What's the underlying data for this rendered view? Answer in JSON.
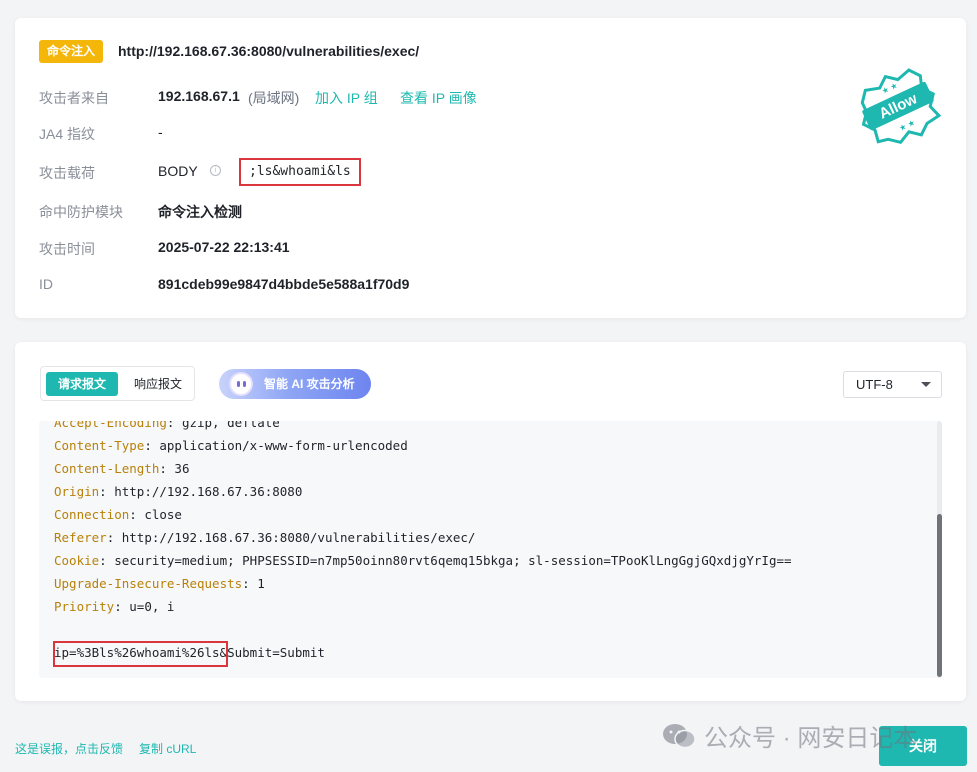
{
  "event": {
    "tag": "命令注入",
    "url": "http://192.168.67.36:8080/vulnerabilities/exec/",
    "stamp_text": "Allow",
    "rows": {
      "source": {
        "label": "攻击者来自",
        "ip": "192.168.67.1",
        "network": "(局域网)",
        "add_ip_group": "加入 IP 组",
        "view_profile": "查看 IP 画像"
      },
      "ja4": {
        "label": "JA4 指纹",
        "value": "-"
      },
      "payload": {
        "label": "攻击载荷",
        "location": "BODY",
        "value": ";ls&whoami&ls"
      },
      "module": {
        "label": "命中防护模块",
        "value": "命令注入检测"
      },
      "time": {
        "label": "攻击时间",
        "value": "2025-07-22 22:13:41"
      },
      "id": {
        "label": "ID",
        "value": "891cdeb99e9847d4bbde5e588a1f70d9"
      }
    }
  },
  "detail": {
    "tabs": {
      "request": "请求报文",
      "response": "响应报文"
    },
    "ai_button": "智能 AI 攻击分析",
    "encoding": "UTF-8",
    "headers": [
      {
        "key": "Accept-Encoding",
        "value": "gzip, deflate"
      },
      {
        "key": "Content-Type",
        "value": "application/x-www-form-urlencoded"
      },
      {
        "key": "Content-Length",
        "value": "36"
      },
      {
        "key": "Origin",
        "value": "http://192.168.67.36:8080"
      },
      {
        "key": "Connection",
        "value": "close"
      },
      {
        "key": "Referer",
        "value": "http://192.168.67.36:8080/vulnerabilities/exec/"
      },
      {
        "key": "Cookie",
        "value": "security=medium; PHPSESSID=n7mp50oinn80rvt6qemq15bkga; sl-session=TPooKlLngGgjGQxdjgYrIg=="
      },
      {
        "key": "Upgrade-Insecure-Requests",
        "value": "1"
      },
      {
        "key": "Priority",
        "value": "u=0, i"
      }
    ],
    "body": "ip=%3Bls%26whoami%26ls&Submit=Submit"
  },
  "footer": {
    "report_false_positive": "这是误报，点击反馈",
    "copy_curl": "复制 cURL",
    "close": "关闭",
    "watermark": "公众号 · 网安日记本"
  },
  "colors": {
    "accent": "#1fb8b0",
    "tag": "#f5b60a",
    "highlight_box": "#d9363e",
    "header_key": "#b8810a"
  }
}
